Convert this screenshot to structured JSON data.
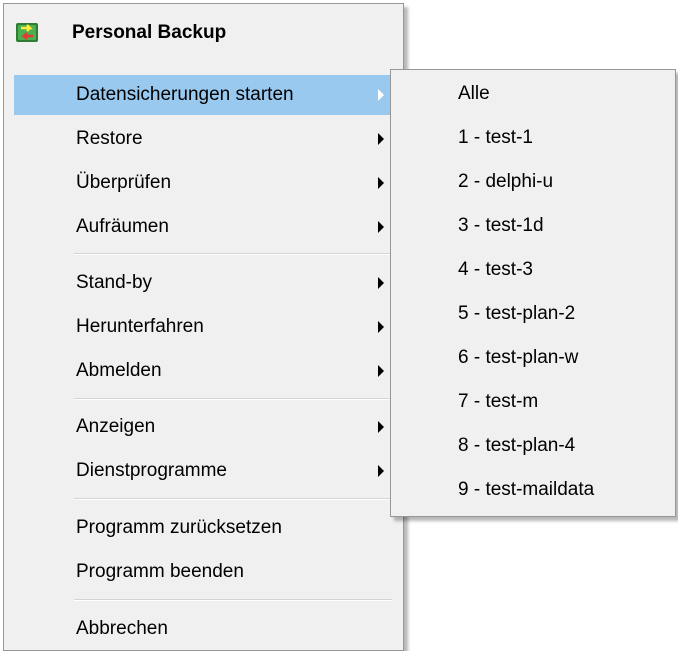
{
  "menu": {
    "title": "Personal Backup",
    "items": [
      {
        "label": "Datensicherungen starten"
      },
      {
        "label": "Restore"
      },
      {
        "label": "Überprüfen"
      },
      {
        "label": "Aufräumen"
      },
      {
        "label": "Stand-by"
      },
      {
        "label": "Herunterfahren"
      },
      {
        "label": "Abmelden"
      },
      {
        "label": "Anzeigen"
      },
      {
        "label": "Dienstprogramme"
      },
      {
        "label": "Programm zurücksetzen"
      },
      {
        "label": "Programm beenden"
      },
      {
        "label": "Abbrechen"
      }
    ],
    "highlight_color": "#99c9ef"
  },
  "submenu": {
    "items": [
      {
        "label": "Alle"
      },
      {
        "label": "1 - test-1"
      },
      {
        "label": "2 - delphi-u"
      },
      {
        "label": "3 - test-1d"
      },
      {
        "label": "4 - test-3"
      },
      {
        "label": "5 - test-plan-2"
      },
      {
        "label": "6 - test-plan-w"
      },
      {
        "label": "7 - test-m"
      },
      {
        "label": "8 - test-plan-4"
      },
      {
        "label": "9 - test-maildata"
      }
    ]
  }
}
